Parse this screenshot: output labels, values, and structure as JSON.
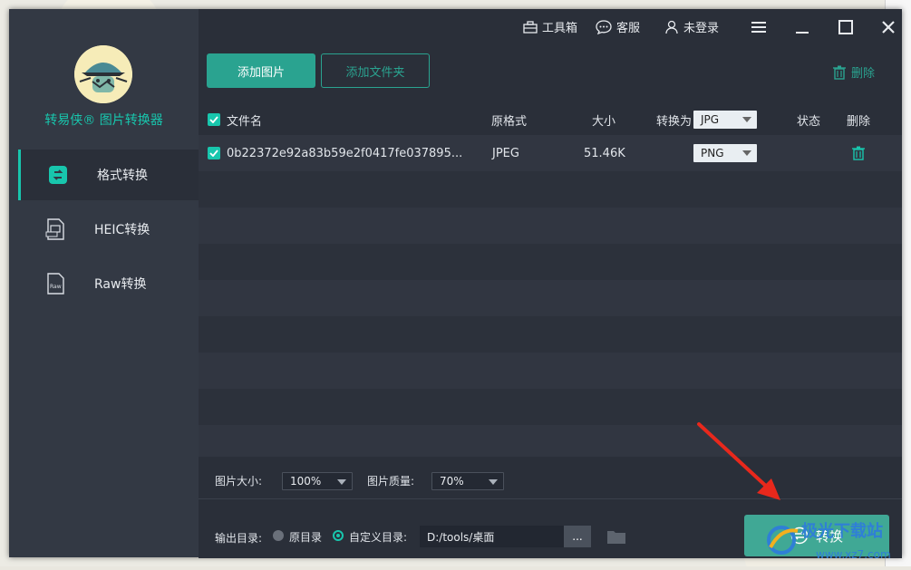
{
  "app": {
    "title": "转易侠® 图片转换器",
    "accent": "#18c6ad"
  },
  "topbar": {
    "toolbox": "工具箱",
    "support": "客服",
    "login": "未登录"
  },
  "sidebar": {
    "items": [
      {
        "label": "格式转换",
        "icon": "format-convert-icon",
        "active": true
      },
      {
        "label": "HEIC转换",
        "icon": "heic-file-icon",
        "active": false
      },
      {
        "label": "Raw转换",
        "icon": "raw-file-icon",
        "active": false
      }
    ]
  },
  "actions": {
    "add_image": "添加图片",
    "add_folder": "添加文件夹",
    "delete_all": "删除"
  },
  "table": {
    "headers": {
      "filename": "文件名",
      "original_format": "原格式",
      "size": "大小",
      "convert_to": "转换为",
      "status": "状态",
      "delete": "删除"
    },
    "global_target_format": "JPG",
    "rows": [
      {
        "filename": "0b22372e92a83b59e2f0417fe037895...",
        "format": "JPEG",
        "size": "51.46K",
        "target": "PNG",
        "status": ""
      }
    ]
  },
  "options": {
    "image_size_label": "图片大小:",
    "image_size_value": "100%",
    "quality_label": "图片质量:",
    "quality_value": "70%"
  },
  "output": {
    "label": "输出目录:",
    "original_dir": "原目录",
    "custom_dir": "自定义目录:",
    "path": "D:/tools/桌面",
    "browse": "...",
    "convert": "转换"
  },
  "watermark": {
    "text": "极光下载站",
    "url": "www.xz7.com"
  }
}
